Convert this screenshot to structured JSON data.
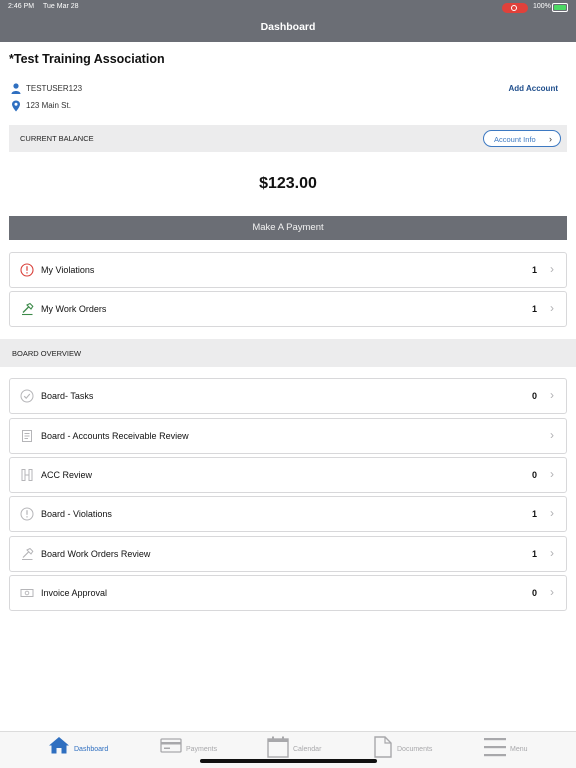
{
  "status_bar": {
    "time": "2:46 PM",
    "date": "Tue Mar 28",
    "battery": "100%"
  },
  "nav": {
    "title": "Dashboard"
  },
  "header": {
    "association": "*Test Training Association",
    "username": "TESTUSER123",
    "address": "123 Main St.",
    "add_account": "Add Account"
  },
  "balance": {
    "label": "CURRENT BALANCE",
    "account_info": "Account Info",
    "amount": "$123.00"
  },
  "payment_button": "Make A Payment",
  "my_items": [
    {
      "label": "My Violations",
      "count": "1",
      "icon": "alert-circle-icon"
    },
    {
      "label": "My Work Orders",
      "count": "1",
      "icon": "hammer-icon"
    }
  ],
  "board_section": {
    "title": "BOARD OVERVIEW"
  },
  "board_items": [
    {
      "label": "Board- Tasks",
      "count": "0",
      "icon": "check-circle-icon"
    },
    {
      "label": "Board - Accounts Receivable Review",
      "count": "",
      "icon": "ledger-icon"
    },
    {
      "label": "ACC Review",
      "count": "0",
      "icon": "columns-icon"
    },
    {
      "label": "Board - Violations",
      "count": "1",
      "icon": "alert-circle-icon"
    },
    {
      "label": "Board Work Orders Review",
      "count": "1",
      "icon": "hammer-icon"
    },
    {
      "label": "Invoice Approval",
      "count": "0",
      "icon": "cash-icon"
    }
  ],
  "tabs": [
    {
      "label": "Dashboard",
      "icon": "home-icon",
      "active": true
    },
    {
      "label": "Payments",
      "icon": "credit-card-icon",
      "active": false
    },
    {
      "label": "Calendar",
      "icon": "calendar-icon",
      "active": false
    },
    {
      "label": "Documents",
      "icon": "document-icon",
      "active": false
    },
    {
      "label": "Menu",
      "icon": "hamburger-icon",
      "active": false
    }
  ],
  "colors": {
    "nav_bg": "#6b6e75",
    "accent_blue": "#2f6fc0",
    "alert_red": "#d9403a",
    "work_green": "#3d8a4a"
  }
}
